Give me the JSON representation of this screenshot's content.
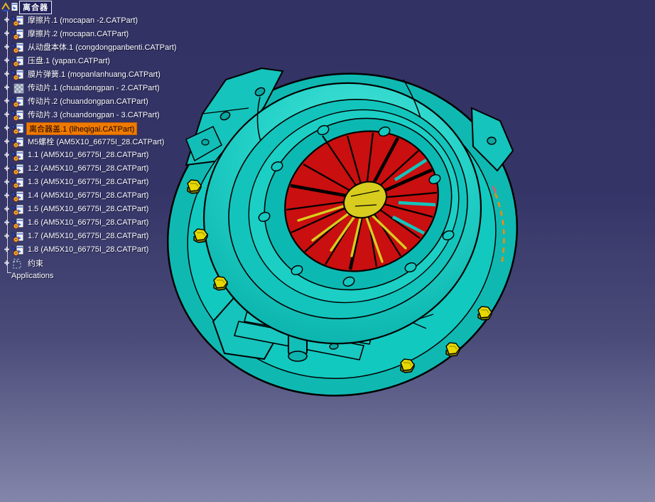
{
  "app": {
    "name": "CATIA assembly design",
    "selected_part": "离合器盖.1"
  },
  "colors": {
    "background_top": "#333366",
    "background_bottom": "#8386a9",
    "tree_text": "#ffffff",
    "selection_highlight": "#ee7a00",
    "selected_edge_dash": "#ff8a00",
    "part_cyan": "#1ecfc6",
    "part_cyan_dark": "#0abbb4",
    "diaphragm_red": "#c90f0f",
    "spring_yellow": "#d8cc1e",
    "bolt_yellow": "#e6d800",
    "edge_black": "#000000"
  },
  "tree": {
    "root": {
      "label": "离合器"
    },
    "items": [
      {
        "text": "摩擦片.1 (mocapan -2.CATPart)",
        "icon": "part",
        "selected": false
      },
      {
        "text": "摩擦片.2 (mocapan.CATPart)",
        "icon": "part",
        "selected": false
      },
      {
        "text": "从动盘本体.1 (congdongpanbenti.CATPart)",
        "icon": "part",
        "selected": false
      },
      {
        "text": "压盘.1 (yapan.CATPart)",
        "icon": "part",
        "selected": false
      },
      {
        "text": "膜片弹簧.1 (mopanlanhuang.CATPart)",
        "icon": "part",
        "selected": false
      },
      {
        "text": "传动片.1 (chuandongpan - 2.CATPart)",
        "icon": "part-hidden",
        "selected": false
      },
      {
        "text": "传动片.2 (chuandongpan.CATPart)",
        "icon": "part",
        "selected": false
      },
      {
        "text": "传动片.3 (chuandongpan - 3.CATPart)",
        "icon": "part",
        "selected": false
      },
      {
        "text": "离合器盖.1 (liheqigai.CATPart)",
        "icon": "part",
        "selected": true
      },
      {
        "text": "M5螺栓 (AM5X10_66775I_28.CATPart)",
        "icon": "part",
        "selected": false
      },
      {
        "text": "1.1 (AM5X10_66775I_28.CATPart)",
        "icon": "part",
        "selected": false
      },
      {
        "text": "1.2 (AM5X10_66775I_28.CATPart)",
        "icon": "part",
        "selected": false
      },
      {
        "text": "1.3 (AM5X10_66775I_28.CATPart)",
        "icon": "part",
        "selected": false
      },
      {
        "text": "1.4 (AM5X10_66775I_28.CATPart)",
        "icon": "part",
        "selected": false
      },
      {
        "text": "1.5 (AM5X10_66775I_28.CATPart)",
        "icon": "part",
        "selected": false
      },
      {
        "text": "1.6 (AM5X10_66775I_28.CATPart)",
        "icon": "part",
        "selected": false
      },
      {
        "text": "1.7 (AM5X10_66775I_28.CATPart)",
        "icon": "part",
        "selected": false
      },
      {
        "text": "1.8 (AM5X10_66775I_28.CATPart)",
        "icon": "part",
        "selected": false
      },
      {
        "text": "约束",
        "icon": "constraints",
        "selected": false
      }
    ],
    "applications_label": "Applications"
  },
  "model": {
    "kind": "3d-clutch-assembly",
    "visible_parts": [
      "clutch cover (cyan)",
      "diaphragm spring (red)",
      "spring finger hub (yellow)",
      "hex bolts (yellow)"
    ]
  }
}
